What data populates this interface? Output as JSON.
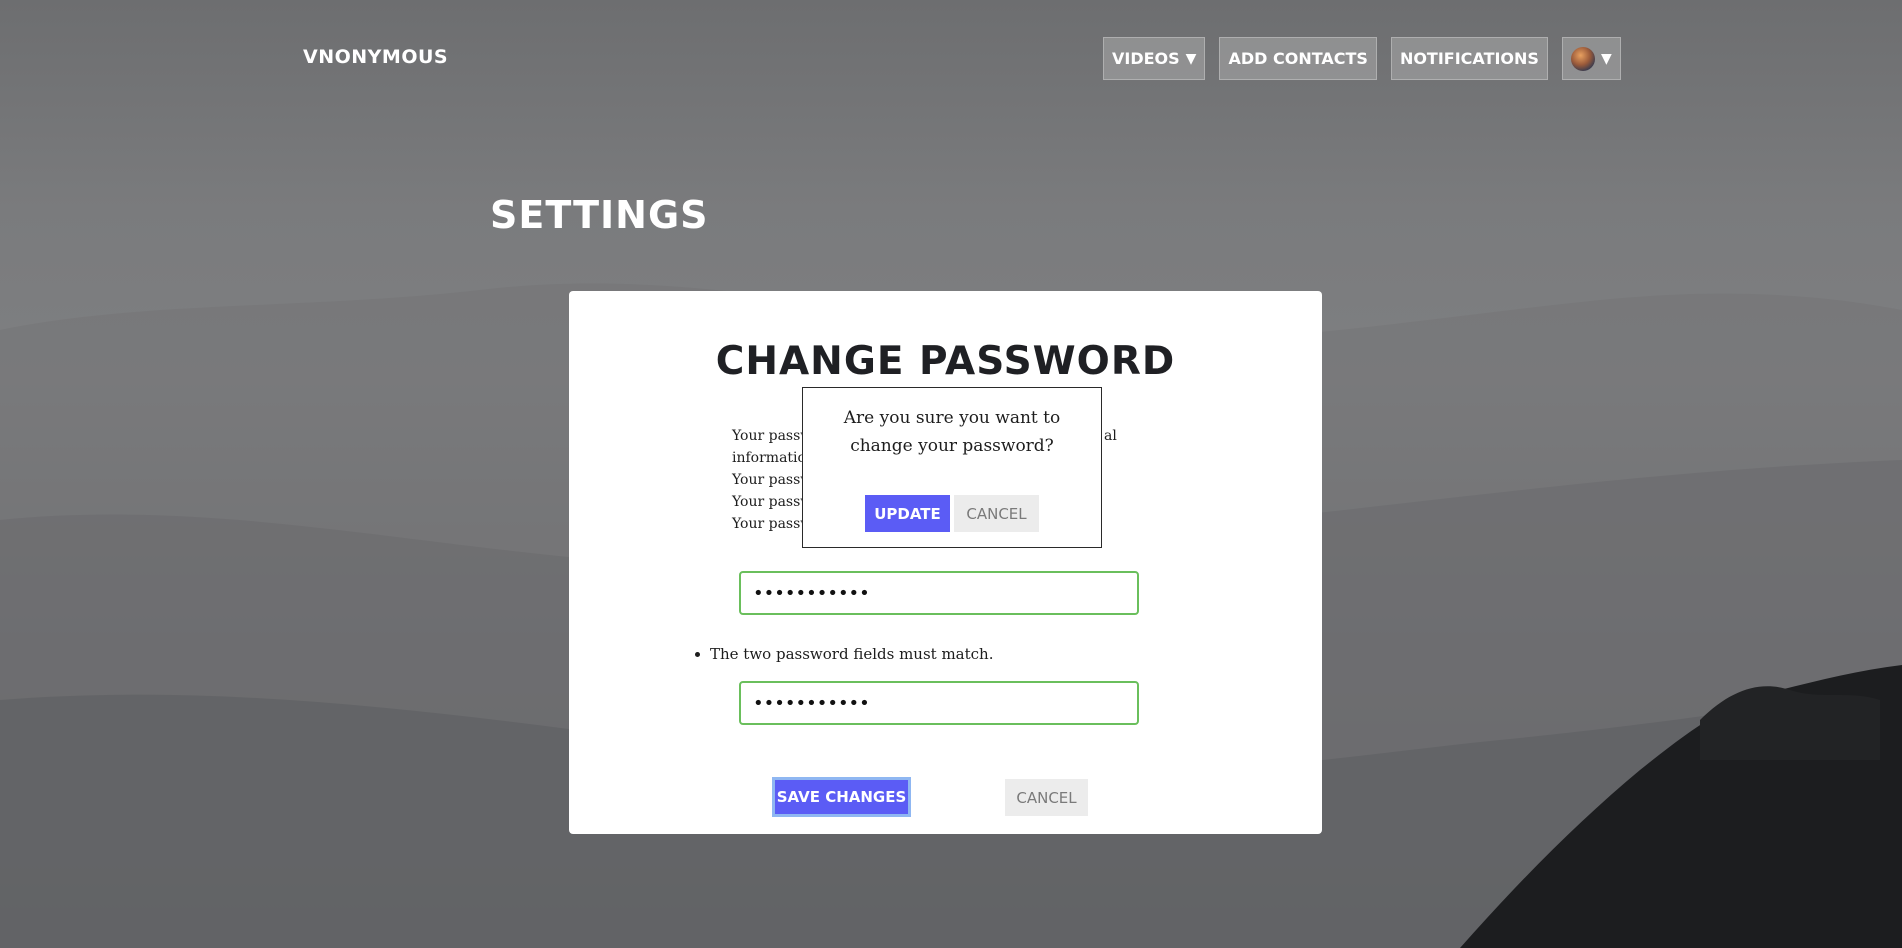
{
  "header": {
    "brand": "VNONYMOUS",
    "nav": {
      "videos_label": "VIDEOS",
      "add_contacts_label": "ADD CONTACTS",
      "notifications_label": "NOTIFICATIONS",
      "dropdown_caret": "▼"
    }
  },
  "page": {
    "title": "SETTINGS"
  },
  "change_password": {
    "title": "CHANGE PASSWORD",
    "rules": [
      "Your passw",
      "informatio",
      "Your passw",
      "Your passw",
      "Your passw"
    ],
    "rules_fragment_right": "al",
    "password_value": "•••••••••••",
    "confirm_value": "•••••••••••",
    "match_error": "The two password fields must match.",
    "save_label": "SAVE CHANGES",
    "cancel_label": "CANCEL"
  },
  "confirm_dialog": {
    "message": "Are you sure you want to change your password?",
    "update_label": "UPDATE",
    "cancel_label": "CANCEL"
  },
  "colors": {
    "accent": "#5b5cf5",
    "valid_border": "#6abf5c",
    "focus_ring": "#8fb7f2"
  }
}
